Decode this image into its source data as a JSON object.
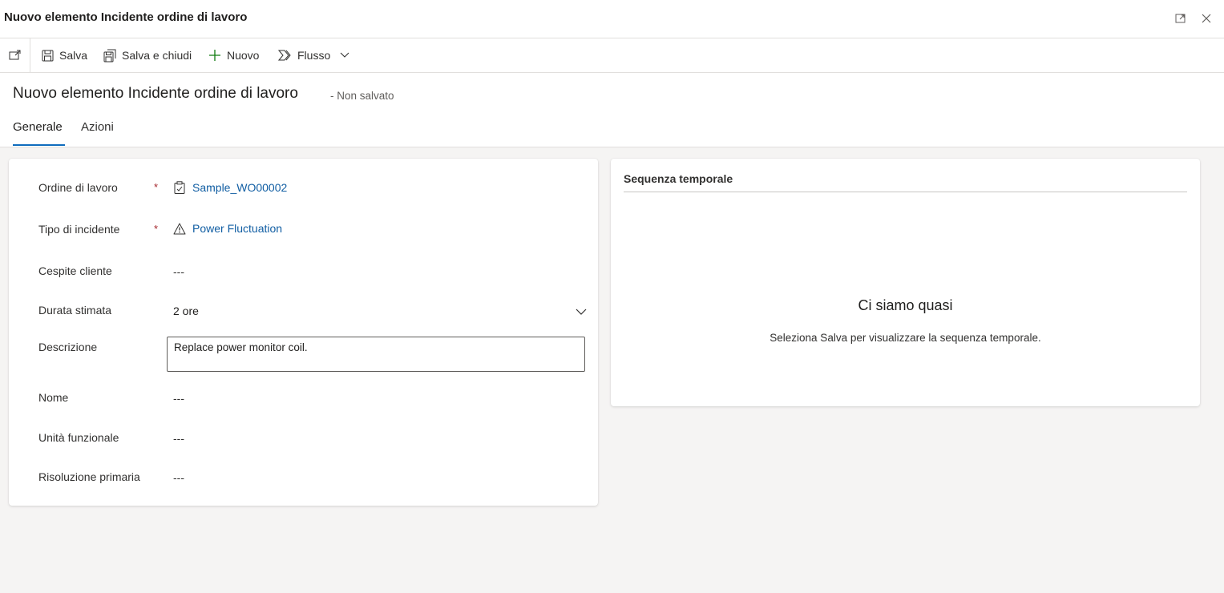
{
  "window": {
    "title": "Nuovo elemento Incidente ordine di lavoro",
    "icons": [
      "expand-icon",
      "close-icon"
    ]
  },
  "commandbar": {
    "buttons": [
      {
        "label": "Salva",
        "icon": "save-icon"
      },
      {
        "label": "Salva e chiudi",
        "icon": "save-close-icon"
      },
      {
        "label": "Nuovo",
        "icon": "plus-icon"
      },
      {
        "label": "Flusso",
        "icon": "flow-icon"
      }
    ]
  },
  "header": {
    "title": "Nuovo elemento Incidente ordine di lavoro",
    "status": "- Non salvato",
    "tabs": [
      {
        "label": "Generale",
        "active": true
      },
      {
        "label": "Azioni",
        "active": false
      }
    ]
  },
  "form": {
    "fields": [
      {
        "label": "Ordine di lavoro",
        "required": "*",
        "value": "Sample_WO00002",
        "type": "lookup",
        "icon": "work-order-icon"
      },
      {
        "label": "Tipo di incidente",
        "required": "*",
        "value": "Power Fluctuation",
        "type": "lookup",
        "icon": "warning-icon"
      },
      {
        "label": "Cespite cliente",
        "value": "---",
        "type": "text"
      },
      {
        "label": "Durata stimata",
        "value": "2 ore",
        "type": "select"
      },
      {
        "label": "Descrizione",
        "value": "Replace power monitor coil.",
        "type": "textarea"
      },
      {
        "label": "Nome",
        "value": "---",
        "type": "text"
      },
      {
        "label": "Unità funzionale",
        "value": "---",
        "type": "text"
      },
      {
        "label": "Risoluzione primaria",
        "value": "---",
        "type": "text"
      }
    ]
  },
  "timeline": {
    "heading": "Sequenza temporale",
    "empty_title": "Ci siamo quasi",
    "empty_text": "Seleziona Salva per visualizzare la sequenza temporale."
  },
  "colors": {
    "accent": "#0f6cbd",
    "link": "#115ea3",
    "required": "#a4262c",
    "background": "#f5f4f3"
  }
}
